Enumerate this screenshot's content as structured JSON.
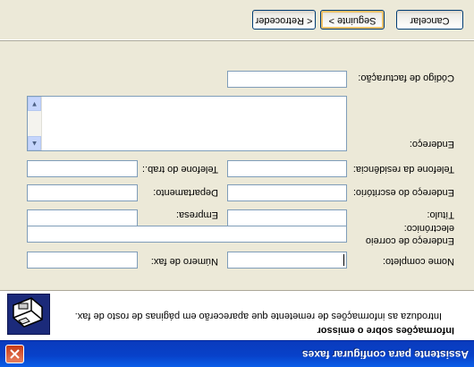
{
  "window": {
    "title": "Assistente para configurar faxes"
  },
  "header": {
    "title": "Informações sobre o emissor",
    "subtitle": "Introduza as informações de remetente que aparecerão em páginas de rosto de fax.",
    "icon": "fax-wizard-icon"
  },
  "form": {
    "full_name_label": "Nome completo:",
    "full_name_value": "",
    "fax_number_label": "Número de fax:",
    "fax_number_value": "",
    "email_label": "Endereço de correio electrónico:",
    "email_value": "",
    "title_label": "Título:",
    "title_value": "",
    "company_label": "Empresa:",
    "company_value": "",
    "office_address_label": "Endereço do escritório:",
    "office_address_value": "",
    "department_label": "Departamento:",
    "department_value": "",
    "home_phone_label": "Telefone da residência:",
    "home_phone_value": "",
    "work_phone_label": "Telefone do trab.:",
    "work_phone_value": "",
    "address_label": "Endereço:",
    "address_value": "",
    "billing_code_label": "Código de facturação:",
    "billing_code_value": ""
  },
  "buttons": {
    "back": "< Retroceder",
    "next": "Seguinte >",
    "cancel": "Cancelar"
  }
}
